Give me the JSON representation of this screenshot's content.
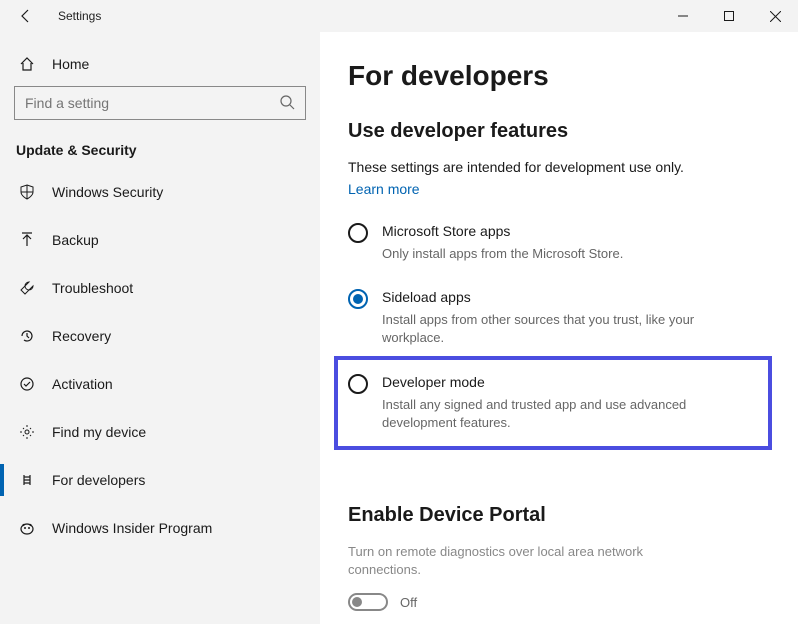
{
  "window": {
    "title": "Settings"
  },
  "sidebar": {
    "home_label": "Home",
    "search_placeholder": "Find a setting",
    "section_header": "Update & Security",
    "items": [
      {
        "label": "Windows Security"
      },
      {
        "label": "Backup"
      },
      {
        "label": "Troubleshoot"
      },
      {
        "label": "Recovery"
      },
      {
        "label": "Activation"
      },
      {
        "label": "Find my device"
      },
      {
        "label": "For developers"
      },
      {
        "label": "Windows Insider Program"
      }
    ]
  },
  "main": {
    "title": "For developers",
    "section1": {
      "heading": "Use developer features",
      "desc": "These settings are intended for development use only.",
      "link": "Learn more",
      "options": [
        {
          "title": "Microsoft Store apps",
          "desc": "Only install apps from the Microsoft Store."
        },
        {
          "title": "Sideload apps",
          "desc": "Install apps from other sources that you trust, like your workplace."
        },
        {
          "title": "Developer mode",
          "desc": "Install any signed and trusted app and use advanced development features."
        }
      ]
    },
    "section2": {
      "heading": "Enable Device Portal",
      "desc": "Turn on remote diagnostics over local area network connections.",
      "toggle_label": "Off"
    }
  }
}
